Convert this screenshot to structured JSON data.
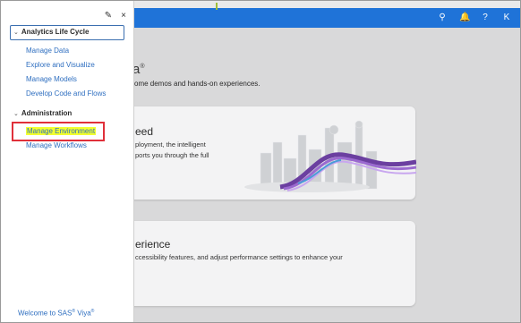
{
  "topbar": {
    "icons": [
      {
        "name": "search-icon",
        "glyph": "⚲"
      },
      {
        "name": "bell-icon",
        "glyph": "🔔"
      },
      {
        "name": "help-icon",
        "glyph": "?"
      },
      {
        "name": "user-initial",
        "glyph": "K"
      }
    ]
  },
  "main": {
    "heading_fragment": "a",
    "heading_sup": "®",
    "sub_fragment": "ome demos and hands-on experiences.",
    "cards": [
      {
        "title": "eed",
        "lines": [
          "ployment, the intelligent",
          "ports you through the full"
        ]
      },
      {
        "title": "erience",
        "lines": [
          "ccessibility features, and adjust performance settings to enhance your"
        ]
      }
    ]
  },
  "panel": {
    "pin_glyph": "✎",
    "close_glyph": "×",
    "sections": [
      {
        "label": "Analytics Life Cycle",
        "items": [
          "Manage Data",
          "Explore and Visualize",
          "Manage Models",
          "Develop Code and Flows"
        ]
      },
      {
        "label": "Administration",
        "items": [
          "Manage Environment",
          "Manage Workflows"
        ]
      }
    ],
    "welcome": "Welcome to SAS",
    "welcome_sup": "®",
    "welcome_tail": " Viya",
    "welcome_sup2": "®"
  },
  "colors": {
    "topbar": "#1f73d8",
    "link": "#2f6fc0",
    "highlight": "#f2ff2f",
    "annotation_box": "#e0303a"
  }
}
